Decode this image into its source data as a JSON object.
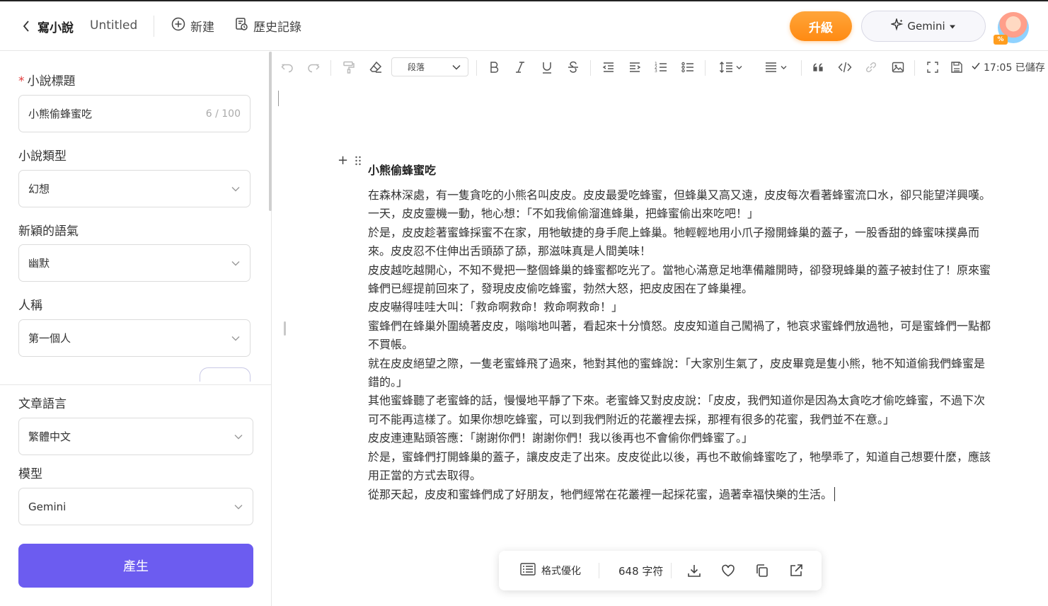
{
  "header": {
    "app_title": "寫小說",
    "doc_name": "Untitled",
    "new_label": "新建",
    "history_label": "歷史記錄",
    "upgrade_label": "升級",
    "model_label": "Gemini",
    "avatar_badge": "%"
  },
  "sidebar": {
    "title_label": "小說標題",
    "title_required_mark": "*",
    "title_value": "小熊偷蜂蜜吃",
    "title_counter": "6 / 100",
    "genre_label": "小說類型",
    "genre_value": "幻想",
    "tone_label": "新穎的語氣",
    "tone_value": "幽默",
    "person_label": "人稱",
    "person_value": "第一個人",
    "language_label": "文章語言",
    "language_value": "繁體中文",
    "model_label": "模型",
    "model_value": "Gemini",
    "generate_label": "產生"
  },
  "toolbar": {
    "paragraph_select": "段落",
    "saved_status": "17:05 已儲存"
  },
  "document": {
    "title": "小熊偷蜂蜜吃",
    "paragraphs": [
      "在森林深處，有一隻貪吃的小熊名叫皮皮。皮皮最愛吃蜂蜜，但蜂巢又高又遠，皮皮每次看著蜂蜜流口水，卻只能望洋興嘆。",
      "一天，皮皮靈機一動，牠心想：「不如我偷偷溜進蜂巢，把蜂蜜偷出來吃吧！」",
      "於是，皮皮趁著蜜蜂採蜜不在家，用牠敏捷的身手爬上蜂巢。牠輕輕地用小爪子撥開蜂巢的蓋子，一股香甜的蜂蜜味撲鼻而來。皮皮忍不住伸出舌頭舔了舔，那滋味真是人間美味！",
      "皮皮越吃越開心，不知不覺把一整個蜂巢的蜂蜜都吃光了。當牠心滿意足地準備離開時，卻發現蜂巢的蓋子被封住了！原來蜜蜂們已經提前回來了，發現皮皮偷吃蜂蜜，勃然大怒，把皮皮困在了蜂巢裡。",
      "皮皮嚇得哇哇大叫：「救命啊救命！救命啊救命！」",
      "蜜蜂們在蜂巢外圍繞著皮皮，嗡嗡地叫著，看起來十分憤怒。皮皮知道自己闖禍了，牠哀求蜜蜂們放過牠，可是蜜蜂們一點都不買帳。",
      "就在皮皮絕望之際，一隻老蜜蜂飛了過來，牠對其他的蜜蜂說：「大家別生氣了，皮皮畢竟是隻小熊，牠不知道偷我們蜂蜜是錯的。」",
      "其他蜜蜂聽了老蜜蜂的話，慢慢地平靜了下來。老蜜蜂又對皮皮說：「皮皮，我們知道你是因為太貪吃才偷吃蜂蜜，不過下次可不能再這樣了。如果你想吃蜂蜜，可以到我們附近的花叢裡去採，那裡有很多的花蜜，我們並不在意。」",
      "皮皮連連點頭答應：「謝謝你們！謝謝你們！我以後再也不會偷你們蜂蜜了。」",
      "於是，蜜蜂們打開蜂巢的蓋子，讓皮皮走了出來。皮皮從此以後，再也不敢偷蜂蜜吃了，牠學乖了，知道自己想要什麼，應該用正當的方式去取得。",
      "從那天起，皮皮和蜜蜂們成了好朋友，牠們經常在花叢裡一起採花蜜，過著幸福快樂的生活。"
    ]
  },
  "float_bar": {
    "format_label": "格式優化",
    "char_count": "648 字符"
  },
  "colors": {
    "accent": "#6c5cf0",
    "upgrade": "#ff9520",
    "required": "#e23c3c"
  }
}
